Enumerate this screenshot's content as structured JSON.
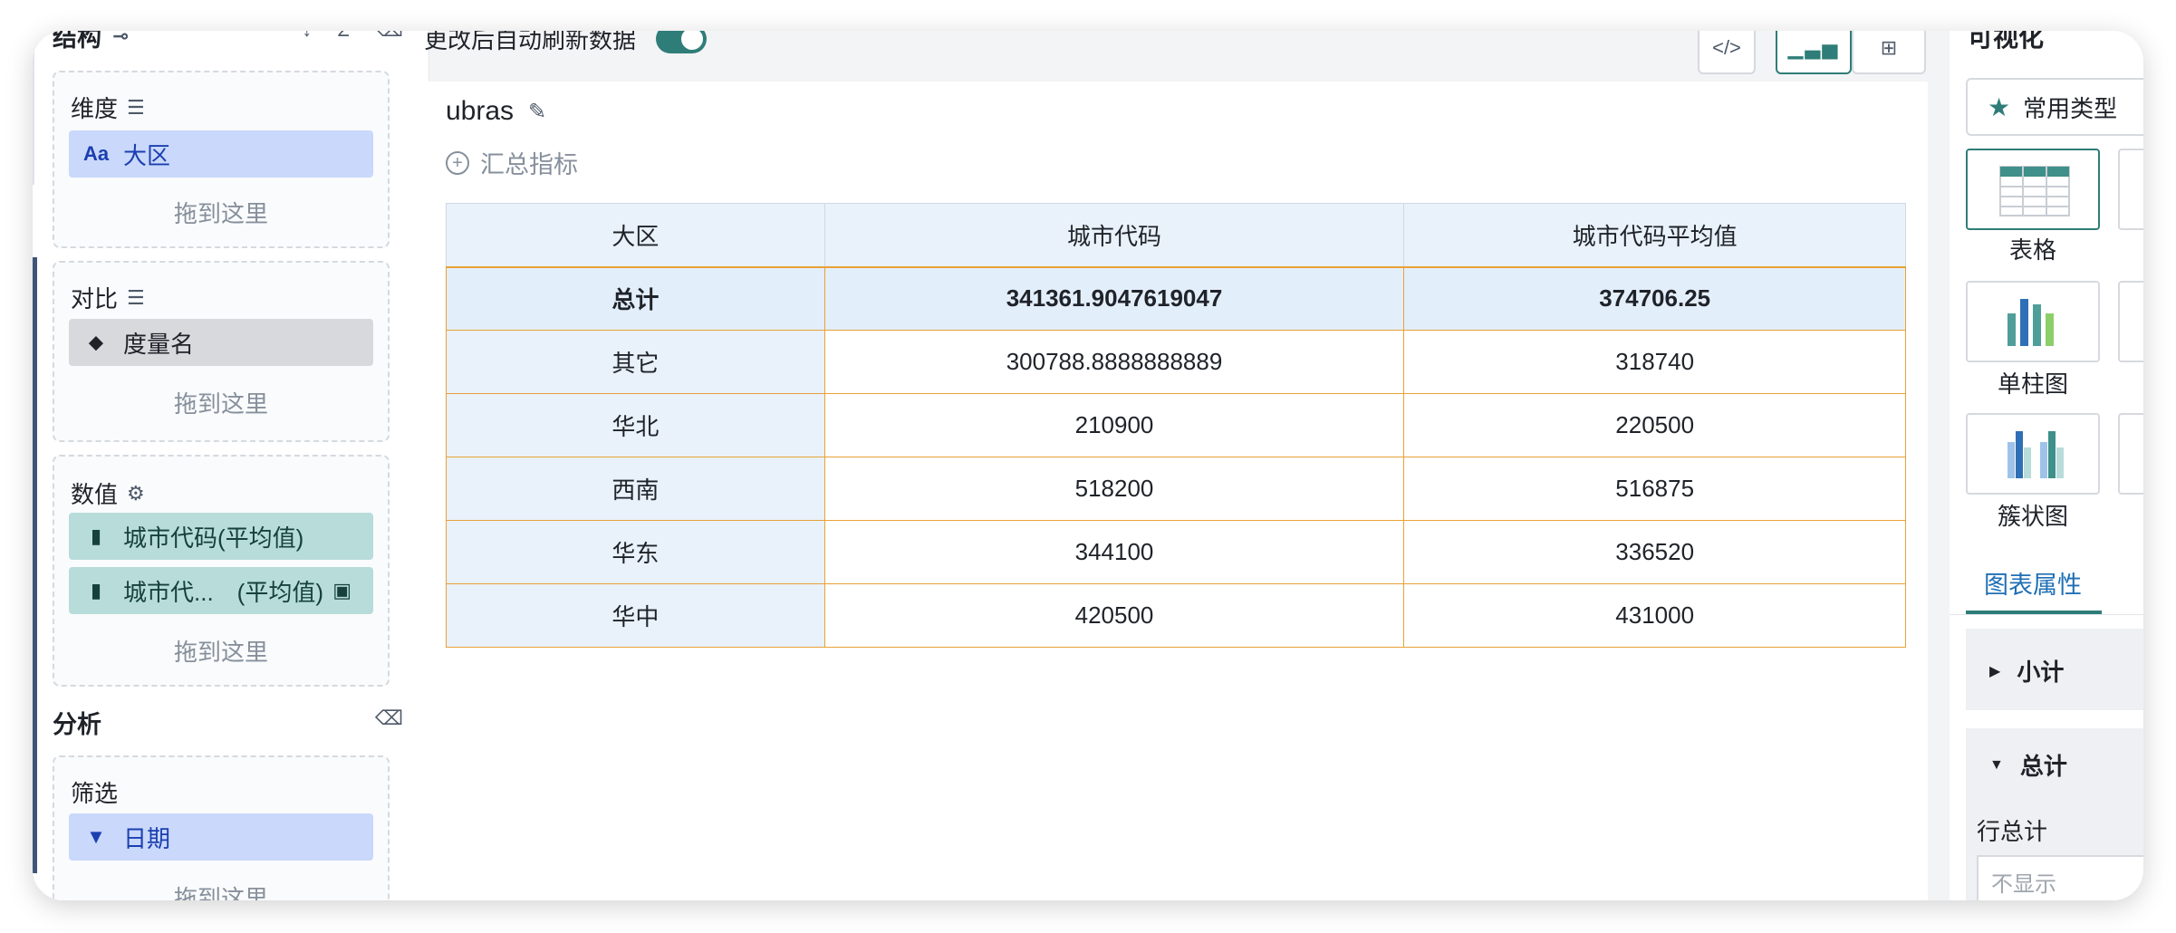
{
  "left": {
    "header": {
      "title": "结构",
      "tools": [
        "↓",
        "Σ",
        "⌫"
      ]
    },
    "dimension": {
      "title": "维度",
      "chip": {
        "icon": "Aa",
        "label": "大区"
      },
      "drop": "拖到这里"
    },
    "compare": {
      "title": "对比",
      "chip": {
        "label": "度量名"
      },
      "drop": "拖到这里"
    },
    "values": {
      "title": "数值",
      "chips": [
        {
          "label": "城市代码(平均值)"
        },
        {
          "label": "城市代...　(平均值)"
        }
      ],
      "drop": "拖到这里"
    },
    "analysis": {
      "title": "分析"
    },
    "filter": {
      "title": "筛选",
      "chip": {
        "label": "日期"
      },
      "drop": "拖到这里"
    }
  },
  "center": {
    "auto_refresh_label": "更改后自动刷新数据",
    "auto_refresh_on": true,
    "view_buttons": [
      "</>",
      "chart",
      "table"
    ],
    "card_title": "ubras",
    "summary_label": "汇总指标",
    "table": {
      "headers": [
        "大区",
        "城市代码",
        "城市代码平均值"
      ],
      "total": [
        "总计",
        "341361.9047619047",
        "374706.25"
      ],
      "rows": [
        [
          "其它",
          "300788.8888888889",
          "318740"
        ],
        [
          "华北",
          "210900",
          "220500"
        ],
        [
          "西南",
          "518200",
          "516875"
        ],
        [
          "华东",
          "344100",
          "336520"
        ],
        [
          "华中",
          "420500",
          "431000"
        ]
      ]
    }
  },
  "right": {
    "title": "可视化",
    "common_label": "常用类型",
    "chart_types": [
      "表格",
      "单柱图",
      "簇状图"
    ],
    "tab_label": "图表属性",
    "subtotal": {
      "title": "小计"
    },
    "grand_total": {
      "title": "总计",
      "row_total_label": "行总计",
      "row_total_value": "不显示"
    }
  },
  "colors": {
    "accent": "#2f7d78",
    "dim_chip": "#c9d8fb",
    "value_chip": "#b7dcda",
    "table_border": "#e8a237",
    "header_bg": "#e9f1fb"
  }
}
